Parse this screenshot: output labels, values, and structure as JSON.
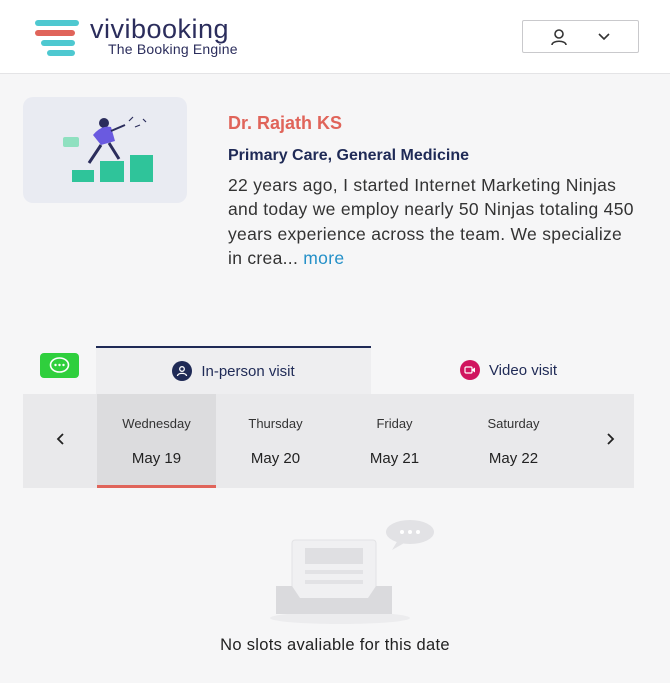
{
  "brand": {
    "name": "vivibooking",
    "tagline": "The Booking Engine"
  },
  "user_menu": {
    "icons": [
      "user-icon",
      "chevron-down-icon"
    ]
  },
  "doctor": {
    "name": "Dr. Rajath KS",
    "specialty": "Primary Care, General Medicine",
    "bio": "22 years ago, I started Internet Marketing Ninjas and today we employ nearly 50 Ninjas totaling 450 years experience across the team. We specialize in crea...",
    "more_label": "more"
  },
  "tabs": [
    {
      "label": "In-person visit",
      "icon": "person-icon",
      "active": true
    },
    {
      "label": "Video visit",
      "icon": "video-icon",
      "active": false
    }
  ],
  "dates": [
    {
      "day": "Wednesday",
      "date": "May 19",
      "active": true
    },
    {
      "day": "Thursday",
      "date": "May 20",
      "active": false
    },
    {
      "day": "Friday",
      "date": "May 21",
      "active": false
    },
    {
      "day": "Saturday",
      "date": "May 22",
      "active": false
    }
  ],
  "empty_state": {
    "message": "No slots avaliable for this date"
  },
  "colors": {
    "accent": "#e0645a",
    "navy": "#1f2a56",
    "link": "#2490c8",
    "chat_green": "#2fcf3d",
    "video_pink": "#d0145e",
    "logo_red": "#e0645a",
    "logo_teal": "#4ec8d0"
  }
}
